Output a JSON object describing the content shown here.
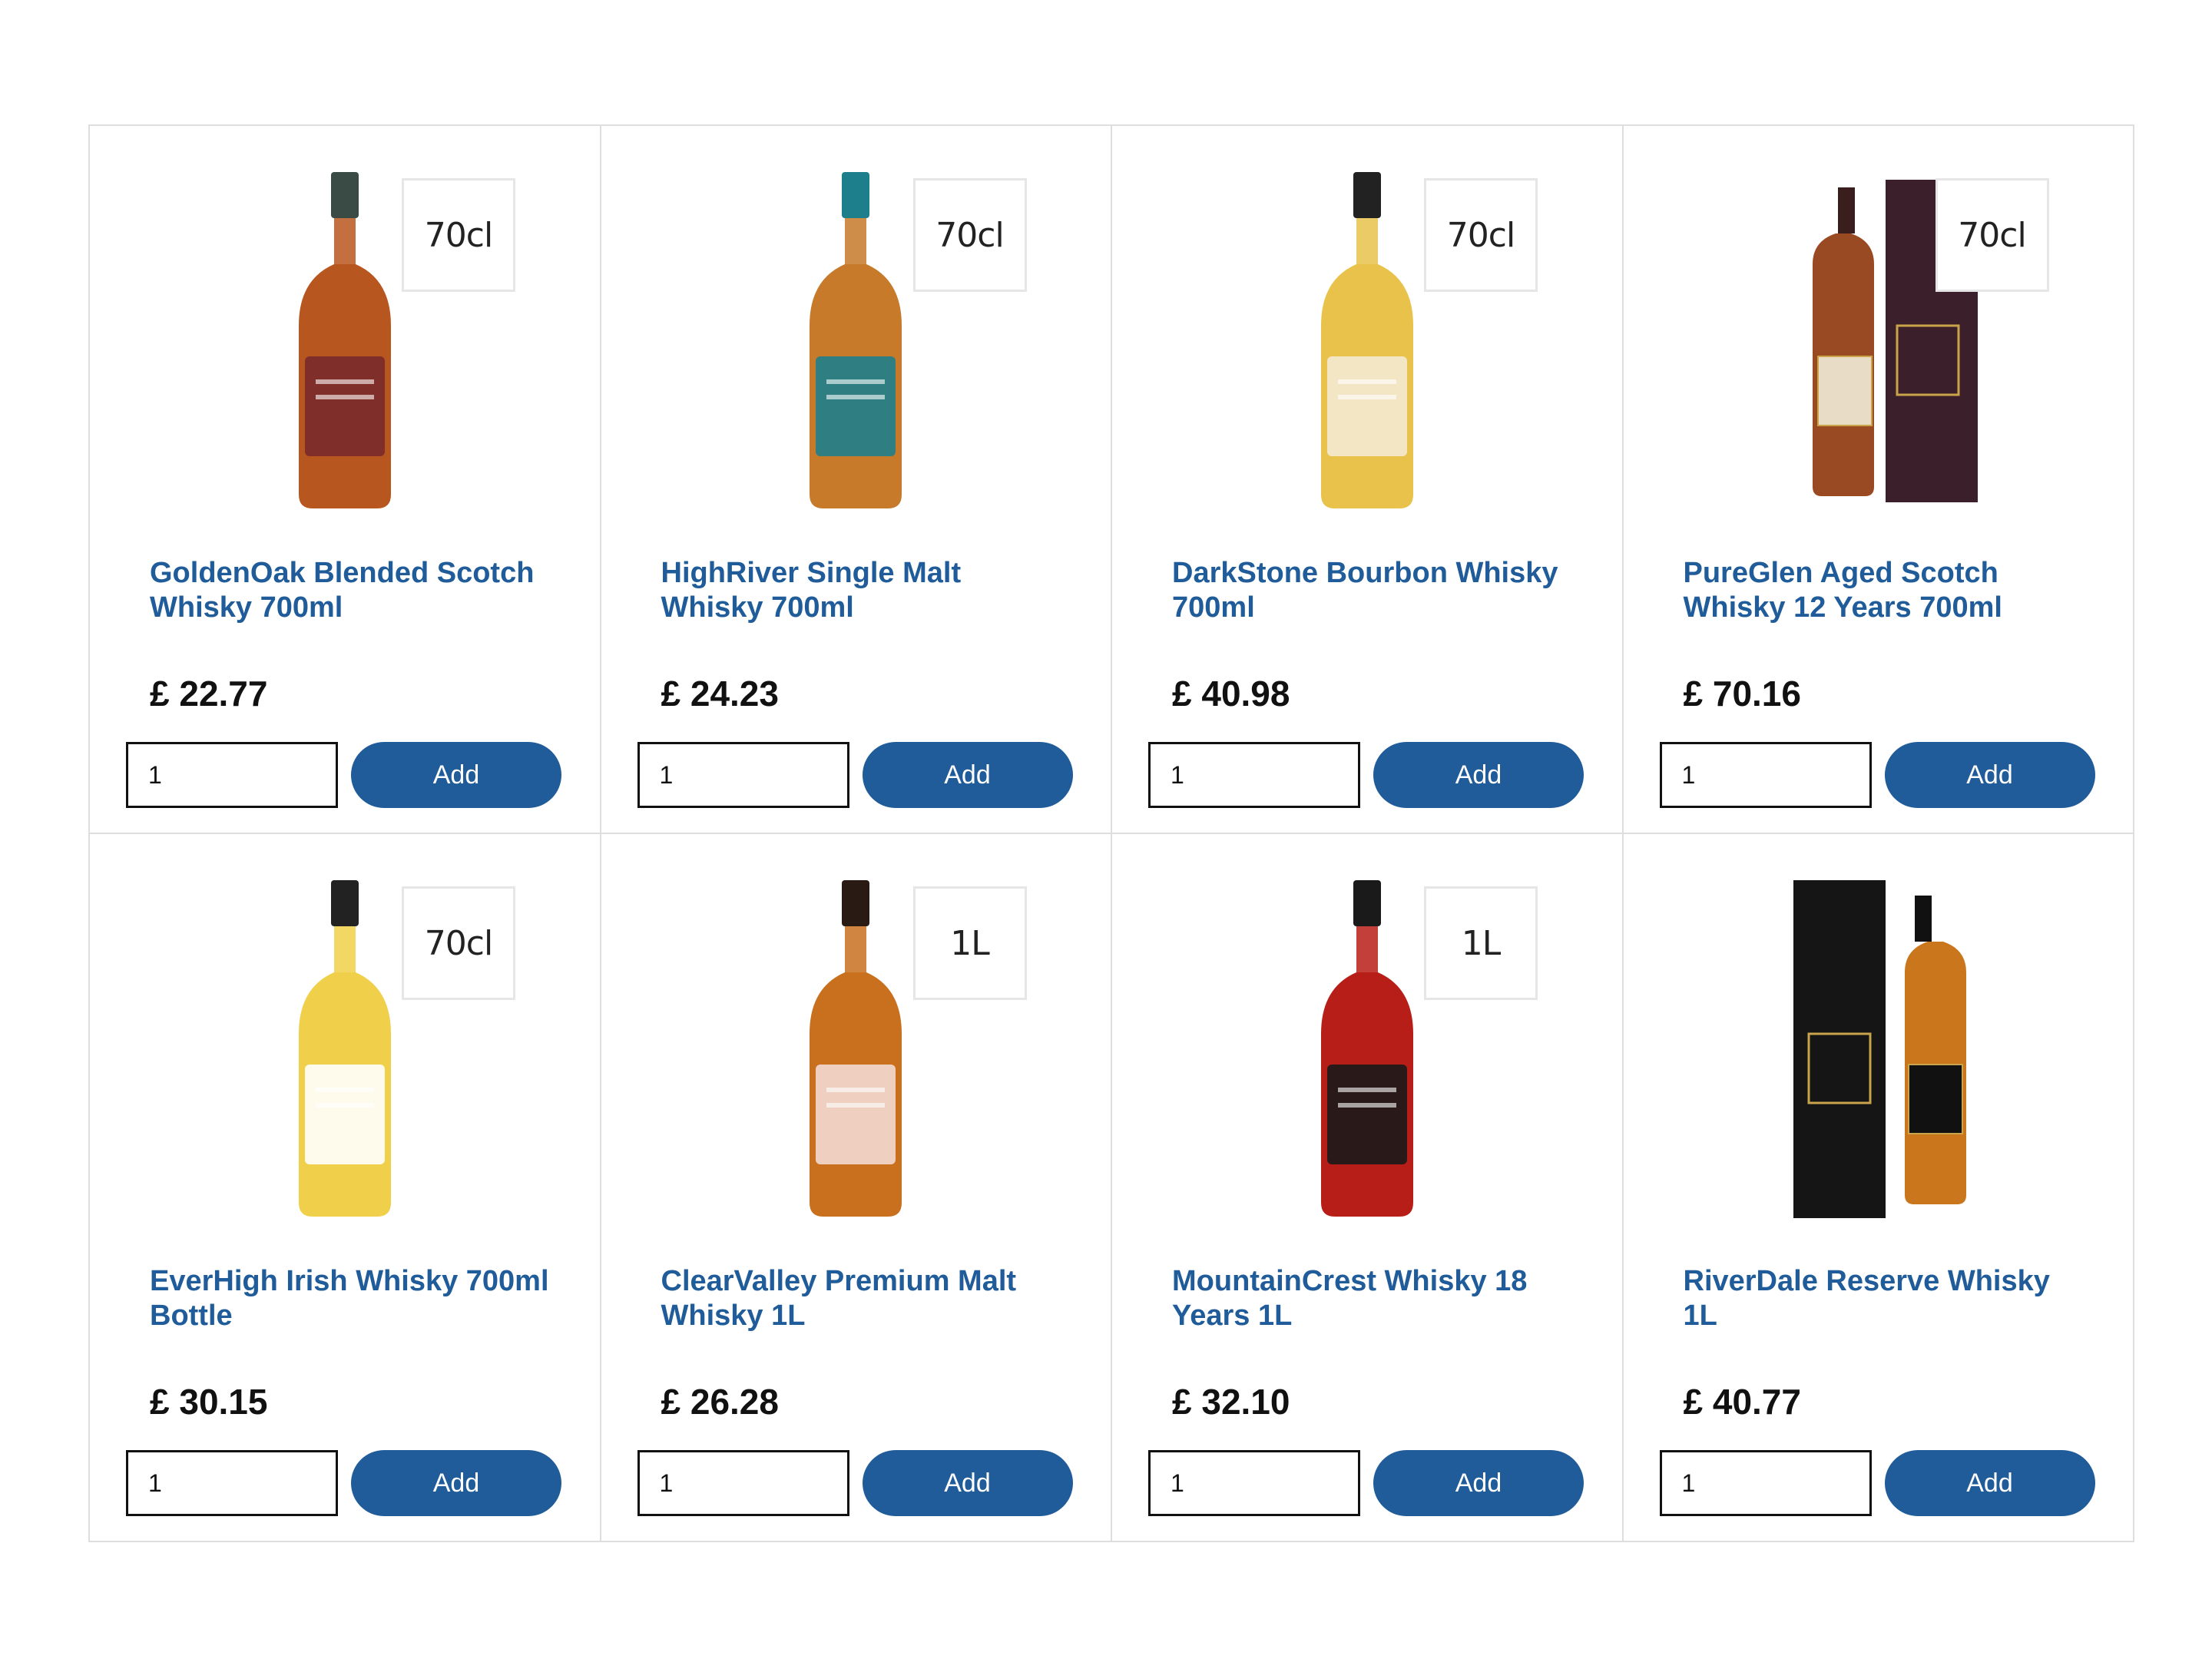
{
  "products": [
    {
      "name": "GoldenOak Blended Scotch Whisky 700ml",
      "price": "£ 22.77",
      "size": "70cl",
      "quantity": "1",
      "add_label": "Add",
      "image_icon": "whisky-bottle-amber",
      "liquid_color": "#b8561f",
      "label_color": "#7a2a2a",
      "cap_color": "#3a4a44"
    },
    {
      "name": "HighRiver Single Malt Whisky 700ml",
      "price": "£ 24.23",
      "size": "70cl",
      "quantity": "1",
      "add_label": "Add",
      "image_icon": "whisky-bottle-teal",
      "liquid_color": "#c67a2a",
      "label_color": "#1e7f8c",
      "cap_color": "#1e7f8c"
    },
    {
      "name": "DarkStone Bourbon Whisky 700ml",
      "price": "£ 40.98",
      "size": "70cl",
      "quantity": "1",
      "add_label": "Add",
      "image_icon": "whisky-bottle-pale",
      "liquid_color": "#e8c24a",
      "label_color": "#f3ead3",
      "cap_color": "#222222"
    },
    {
      "name": "PureGlen Aged Scotch Whisky 12 Years 700ml",
      "price": "£ 70.16",
      "size": "70cl",
      "quantity": "1",
      "add_label": "Add",
      "image_icon": "whisky-bottle-with-box",
      "liquid_color": "#9a4a22",
      "label_color": "#e8dcc6",
      "cap_color": "#3a1e1e"
    },
    {
      "name": "EverHigh Irish Whisky 700ml Bottle",
      "price": "£ 30.15",
      "size": "70cl",
      "quantity": "1",
      "add_label": "Add",
      "image_icon": "whisky-bottle-square",
      "liquid_color": "#f0d04a",
      "label_color": "#ffffff",
      "cap_color": "#222222"
    },
    {
      "name": "ClearValley Premium Malt Whisky 1L",
      "price": "£ 26.28",
      "size": "1L",
      "quantity": "1",
      "add_label": "Add",
      "image_icon": "whisky-bottle-grouse",
      "liquid_color": "#c8701e",
      "label_color": "#f2d9d2",
      "cap_color": "#2a1a14"
    },
    {
      "name": "MountainCrest Whisky 18 Years 1L",
      "price": "£ 32.10",
      "size": "1L",
      "quantity": "1",
      "add_label": "Add",
      "image_icon": "whisky-bottle-red",
      "liquid_color": "#b81e18",
      "label_color": "#1a1a1a",
      "cap_color": "#1a1a1a"
    },
    {
      "name": "RiverDale Reserve Whisky 1L",
      "price": "£ 40.77",
      "size": "",
      "quantity": "1",
      "add_label": "Add",
      "image_icon": "whisky-bottle-black-box",
      "liquid_color": "#c9761c",
      "label_color": "#111111",
      "cap_color": "#111111"
    }
  ]
}
